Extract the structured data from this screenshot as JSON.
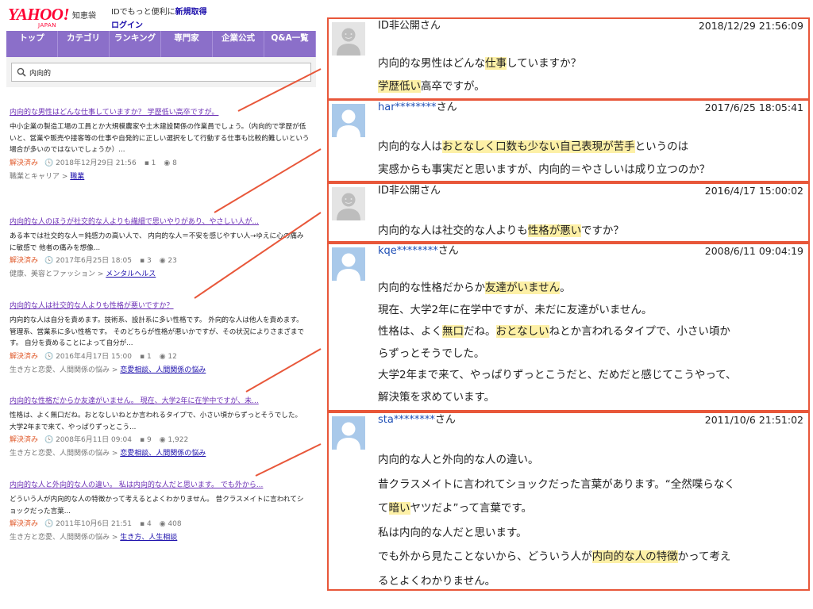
{
  "header": {
    "logo_main": "YAHOO!",
    "logo_sub": "JAPAN",
    "service_name": "知恵袋",
    "promo_text": "IDでもっと便利に",
    "promo_link": "新規取得",
    "login_link": "ログイン"
  },
  "nav": {
    "tabs": [
      {
        "label": "トップ"
      },
      {
        "label": "カテゴリ"
      },
      {
        "label": "ランキング"
      },
      {
        "label": "専門家"
      },
      {
        "label": "企業公式"
      },
      {
        "label": "Q&A一覧"
      }
    ]
  },
  "search": {
    "icon": "magnifier-icon",
    "query": "内向的"
  },
  "results": [
    {
      "title": "内向的な男性はどんな仕事していますか？ 学歴低い高卒ですが。",
      "snippet": "中小企業の製造工場の工員とか大規模農家や土木建設関係の作業員でしょう。（内向的で学歴が低いと、営業や販売や接客等の仕事や自発的に正しい選択をして行動する仕事も比較的難しいという場合が多いのではないでしょうか）...",
      "status": "解決済み",
      "date": "2018年12月29日 21:56",
      "answers": "1",
      "views": "8",
      "category_parent": "職業とキャリア",
      "category": "職業"
    },
    {
      "title": "内向的な人のほうが社交的な人よりも繊細で思いやりがあり、やさしい人が...",
      "snippet": "ある本では社交的な人＝鈍感力の高い人で、 内向的な人＝不安を感じやすい人→ゆえに心の痛みに敏感で 他者の痛みを想像...",
      "status": "解決済み",
      "date": "2017年6月25日 18:05",
      "answers": "3",
      "views": "23",
      "category_parent": "健康、美容とファッション",
      "category": "メンタルヘルス"
    },
    {
      "title": "内向的な人は社交的な人よりも性格が悪いですか？",
      "snippet": "内向的な人は自分を責めます。技術系、設計系に多い性格です。 外向的な人は他人を責めます。管理系、営業系に多い性格です。 そのどちらが性格が悪いかですが、その状況によりさまざまです。 自分を責めることによって自分が...",
      "status": "解決済み",
      "date": "2016年4月17日 15:00",
      "answers": "1",
      "views": "12",
      "category_parent": "生き方と恋愛、人間関係の悩み",
      "category": "恋愛相談、人間関係の悩み"
    },
    {
      "title": "内向的な性格だからか友達がいません。 現在、大学2年に在学中ですが、未...",
      "snippet": "性格は、よく無口だね。おとなしいねとか言われるタイプで、小さい頃からずっとそうでした。 大学2年まで来て、やっぱりずっとこう...",
      "status": "解決済み",
      "date": "2008年6月11日 09:04",
      "answers": "9",
      "views": "1,922",
      "category_parent": "生き方と恋愛、人間関係の悩み",
      "category": "恋愛相談、人間関係の悩み"
    },
    {
      "title": "内向的な人と外向的な人の違い。 私は内向的な人だと思います。 でも外から...",
      "snippet": "どういう人が内向的な人の特徴かって考えるとよくわかりません。 昔クラスメイトに言われてショックだった言葉...",
      "status": "解決済み",
      "date": "2011年10月6日 21:51",
      "answers": "4",
      "views": "408",
      "category_parent": "生き方と恋愛、人間関係の悩み",
      "category": "生き方、人生相談"
    }
  ],
  "panels": [
    {
      "avatar": "anonymous-avatar-icon",
      "user": "ID非公開",
      "user_masked": false,
      "suffix": "さん",
      "date": "2018/12/29",
      "time": "21:56:09",
      "lines": [
        [
          {
            "t": "内向的な男性はどんな"
          },
          {
            "t": "仕事",
            "hl": true
          },
          {
            "t": "していますか？"
          }
        ],
        [
          {
            "t": "学歴低い",
            "hl": true
          },
          {
            "t": "高卒ですが。"
          }
        ]
      ]
    },
    {
      "avatar": "default-avatar-icon",
      "user": "har********",
      "user_masked": true,
      "suffix": "さん",
      "date": "2017/6/25",
      "time": "18:05:41",
      "lines": [
        [
          {
            "t": "内向的な人は"
          },
          {
            "t": "おとなしく口数も少ない自己表現が苦手",
            "hl": true
          },
          {
            "t": "というのは"
          }
        ],
        [
          {
            "t": "実感からも事実だと思いますが、内向的＝やさしいは成り立つのか？"
          }
        ]
      ]
    },
    {
      "avatar": "anonymous-avatar-icon",
      "user": "ID非公開",
      "user_masked": false,
      "suffix": "さん",
      "date": "2016/4/17",
      "time": "15:00:02",
      "lines": [
        [
          {
            "t": "内向的な人は社交的な人よりも"
          },
          {
            "t": "性格が悪い",
            "hl": true
          },
          {
            "t": "ですか？"
          }
        ]
      ]
    },
    {
      "avatar": "default-avatar-icon",
      "user": "kqe********",
      "user_masked": true,
      "suffix": "さん",
      "date": "2008/6/11",
      "time": "09:04:19",
      "lines": [
        [
          {
            "t": "内向的な性格だからか"
          },
          {
            "t": "友達がいません",
            "hl": true
          },
          {
            "t": "。"
          }
        ],
        [
          {
            "t": "現在、大学2年に在学中ですが、未だに友達がいません。"
          }
        ],
        [
          {
            "t": "性格は、よく"
          },
          {
            "t": "無口",
            "hl": true
          },
          {
            "t": "だね。"
          },
          {
            "t": "おとなしい",
            "hl": true
          },
          {
            "t": "ねとか言われるタイプで、小さい頃か"
          }
        ],
        [
          {
            "t": "らずっとそうでした。"
          }
        ],
        [
          {
            "t": "大学2年まで来て、やっぱりずっとこうだと、だめだと感じてこうやって、"
          }
        ],
        [
          {
            "t": "解決策を求めています。"
          }
        ]
      ]
    },
    {
      "avatar": "default-avatar-icon",
      "user": "sta********",
      "user_masked": true,
      "suffix": "さん",
      "date": "2011/10/6",
      "time": "21:51:02",
      "lines": [
        [
          {
            "t": "内向的な人と外向的な人の違い。"
          }
        ],
        [
          {
            "t": "昔クラスメイトに言われてショックだった言葉があります。“全然喋らなく"
          }
        ],
        [
          {
            "t": "て"
          },
          {
            "t": "暗い",
            "hl": true
          },
          {
            "t": "ヤツだよ”って言葉です。"
          }
        ],
        [
          {
            "t": "私は内向的な人だと思います。"
          }
        ],
        [
          {
            "t": "でも外から見たことないから、どういう人が"
          },
          {
            "t": "内向的な人の特徴",
            "hl": true
          },
          {
            "t": "かって考え"
          }
        ],
        [
          {
            "t": "るとよくわかりません。"
          }
        ]
      ]
    }
  ],
  "colors": {
    "accent": "#e8573a",
    "highlight": "#fdf0a6",
    "nav": "#8b6fc9",
    "link": "#1a0dab",
    "visited_link": "#6b2fb5",
    "solved": "#e05a2b"
  }
}
